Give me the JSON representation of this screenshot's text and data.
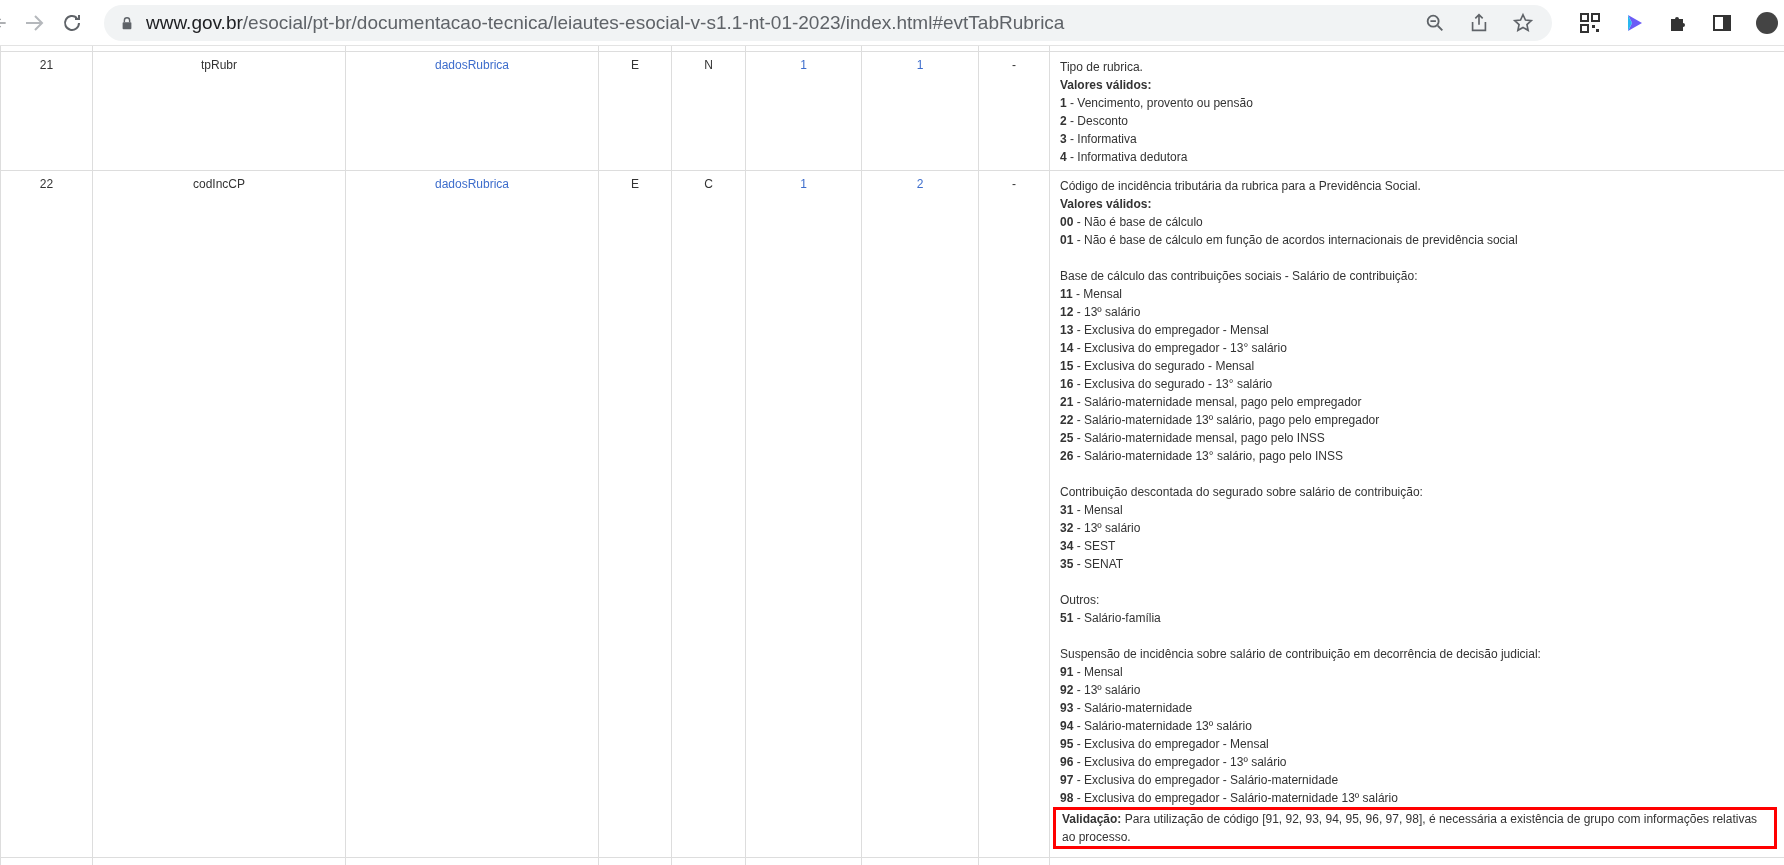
{
  "browser": {
    "url_host": "www.gov.br",
    "url_path": "/esocial/pt-br/documentacao-tecnica/leiautes-esocial-v-s1.1-nt-01-2023/index.html#evtTabRubrica"
  },
  "table": {
    "rows": [
      {
        "cells": [
          {
            "text": "21",
            "link": false
          },
          {
            "text": "tpRubr",
            "link": false
          },
          {
            "text": "dadosRubrica",
            "link": true
          },
          {
            "text": "E",
            "link": false
          },
          {
            "text": "N",
            "link": false
          },
          {
            "text": "1",
            "link": true
          },
          {
            "text": "1",
            "link": true
          },
          {
            "text": "-",
            "link": false
          }
        ],
        "description": {
          "groups": [
            [
              "Tipo de rubrica.",
              "**Valores válidos:**",
              "**1** - Vencimento, provento ou pensão",
              "**2** - Desconto",
              "**3** - Informativa",
              "**4** - Informativa dedutora"
            ]
          ]
        }
      },
      {
        "cells": [
          {
            "text": "22",
            "link": false
          },
          {
            "text": "codIncCP",
            "link": false
          },
          {
            "text": "dadosRubrica",
            "link": true
          },
          {
            "text": "E",
            "link": false
          },
          {
            "text": "C",
            "link": false
          },
          {
            "text": "1",
            "link": true
          },
          {
            "text": "2",
            "link": true
          },
          {
            "text": "-",
            "link": false
          }
        ],
        "description": {
          "groups": [
            [
              "Código de incidência tributária da rubrica para a Previdência Social.",
              "**Valores válidos:**",
              "**00** - Não é base de cálculo",
              "**01** - Não é base de cálculo em função de acordos internacionais de previdência social"
            ],
            [
              "Base de cálculo das contribuições sociais - Salário de contribuição:",
              "**11** - Mensal",
              "**12** - 13º salário",
              "**13** - Exclusiva do empregador - Mensal",
              "**14** - Exclusiva do empregador - 13° salário",
              "**15** - Exclusiva do segurado - Mensal",
              "**16** - Exclusiva do segurado - 13° salário",
              "**21** - Salário-maternidade mensal, pago pelo empregador",
              "**22** - Salário-maternidade 13º salário, pago pelo empregador",
              "**25** - Salário-maternidade mensal, pago pelo INSS",
              "**26** - Salário-maternidade 13° salário, pago pelo INSS"
            ],
            [
              "Contribuição descontada do segurado sobre salário de contribuição:",
              "**31** - Mensal",
              "**32** - 13º salário",
              "**34** - SEST",
              "**35** - SENAT"
            ],
            [
              "Outros:",
              "**51** - Salário-família"
            ],
            [
              "Suspensão de incidência sobre salário de contribuição em decorrência de decisão judicial:",
              "**91** - Mensal",
              "**92** - 13º salário",
              "**93** - Salário-maternidade",
              "**94** - Salário-maternidade 13º salário",
              "**95** - Exclusiva do empregador - Mensal",
              "**96** - Exclusiva do empregador - 13º salário",
              "**97** - Exclusiva do empregador - Salário-maternidade",
              "**98** - Exclusiva do empregador - Salário-maternidade 13º salário"
            ]
          ],
          "validation": {
            "text": "**Validação:** Para utilização de código [91, 92, 93, 94, 95, 96, 97, 98], é necessária a existência de grupo com informações relativas ao processo.",
            "highlighted": true
          }
        }
      }
    ]
  }
}
